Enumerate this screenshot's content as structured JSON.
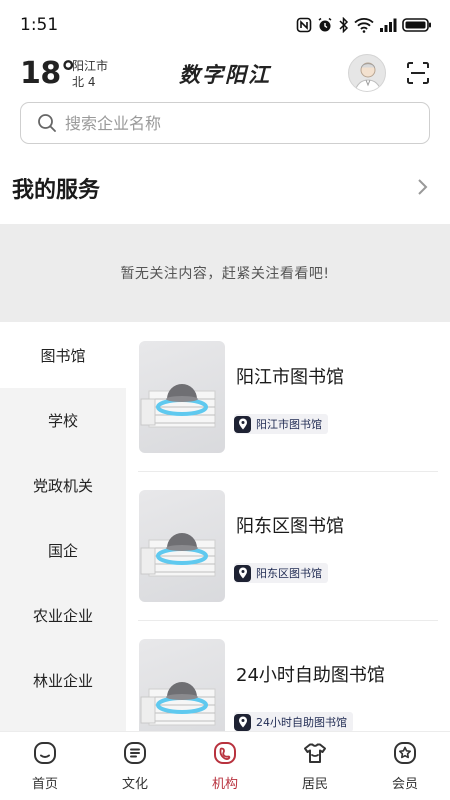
{
  "status_bar": {
    "time": "1:51",
    "icons": [
      "nfc-icon",
      "alarm-icon",
      "bluetooth-icon",
      "wifi-icon",
      "signal-icon",
      "battery-icon"
    ]
  },
  "header": {
    "temperature": "18°",
    "city": "阳江市",
    "wind": "北 4",
    "app_title": "数字阳江"
  },
  "search": {
    "placeholder": "搜索企业名称",
    "value": ""
  },
  "services": {
    "title": "我的服务",
    "empty_text": "暂无关注内容，赶紧关注看看吧!"
  },
  "categories": [
    {
      "label": "图书馆",
      "active": true
    },
    {
      "label": "学校",
      "active": false
    },
    {
      "label": "党政机关",
      "active": false
    },
    {
      "label": "国企",
      "active": false
    },
    {
      "label": "农业企业",
      "active": false
    },
    {
      "label": "林业企业",
      "active": false
    }
  ],
  "institutions": [
    {
      "name": "阳江市图书馆",
      "tag": "阳江市图书馆"
    },
    {
      "name": "阳东区图书馆",
      "tag": "阳东区图书馆"
    },
    {
      "name": "24小时自助图书馆",
      "tag": "24小时自助图书馆"
    }
  ],
  "tabbar": [
    {
      "label": "首页",
      "icon": "home-icon",
      "active": false
    },
    {
      "label": "文化",
      "icon": "culture-icon",
      "active": false
    },
    {
      "label": "机构",
      "icon": "institution-icon",
      "active": true
    },
    {
      "label": "居民",
      "icon": "resident-icon",
      "active": false
    },
    {
      "label": "会员",
      "icon": "member-icon",
      "active": false
    }
  ],
  "colors": {
    "accent": "#b8323e",
    "tag_text": "#1f2a52",
    "tag_bg": "#f1f1f4",
    "empty_bg": "#ececec",
    "sidebar_bg": "#f3f3f3"
  }
}
